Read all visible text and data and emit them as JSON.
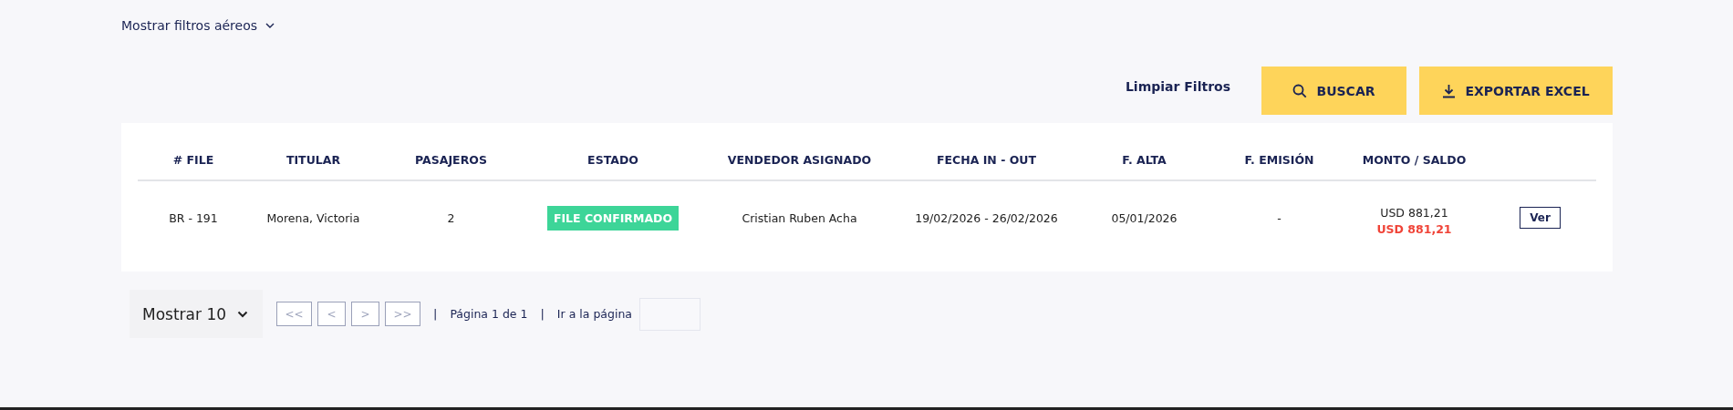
{
  "filters_toggle": {
    "label": "Mostrar filtros aéreos"
  },
  "actions": {
    "clear": "Limpiar Filtros",
    "search": "BUSCAR",
    "export": "EXPORTAR EXCEL"
  },
  "table": {
    "columns": [
      "# FILE",
      "TITULAR",
      "PASAJEROS",
      "ESTADO",
      "VENDEDOR ASIGNADO",
      "FECHA IN - OUT",
      "F. ALTA",
      "F. EMISIÓN",
      "MONTO / SALDO"
    ],
    "rows": [
      {
        "file": "BR - 191",
        "titular": "Morena, Victoria",
        "pasajeros": "2",
        "estado": {
          "label": "FILE CONFIRMADO",
          "color": "#3dd598"
        },
        "vendedor": "Cristian Ruben Acha",
        "fechas": "19/02/2026 - 26/02/2026",
        "alta": "05/01/2026",
        "emision": "-",
        "monto": "USD 881,21",
        "saldo": "USD 881,21",
        "action": "Ver"
      }
    ]
  },
  "pagination": {
    "page_size": "Mostrar 10",
    "nav": [
      {
        "label": "<<",
        "disabled": true
      },
      {
        "label": "<",
        "disabled": true
      },
      {
        "label": ">",
        "disabled": true
      },
      {
        "label": ">>",
        "disabled": true
      }
    ],
    "separator_1": "|",
    "page_info": "Página 1 de 1",
    "separator_2": "|",
    "goto_label": "Ir a la página"
  }
}
